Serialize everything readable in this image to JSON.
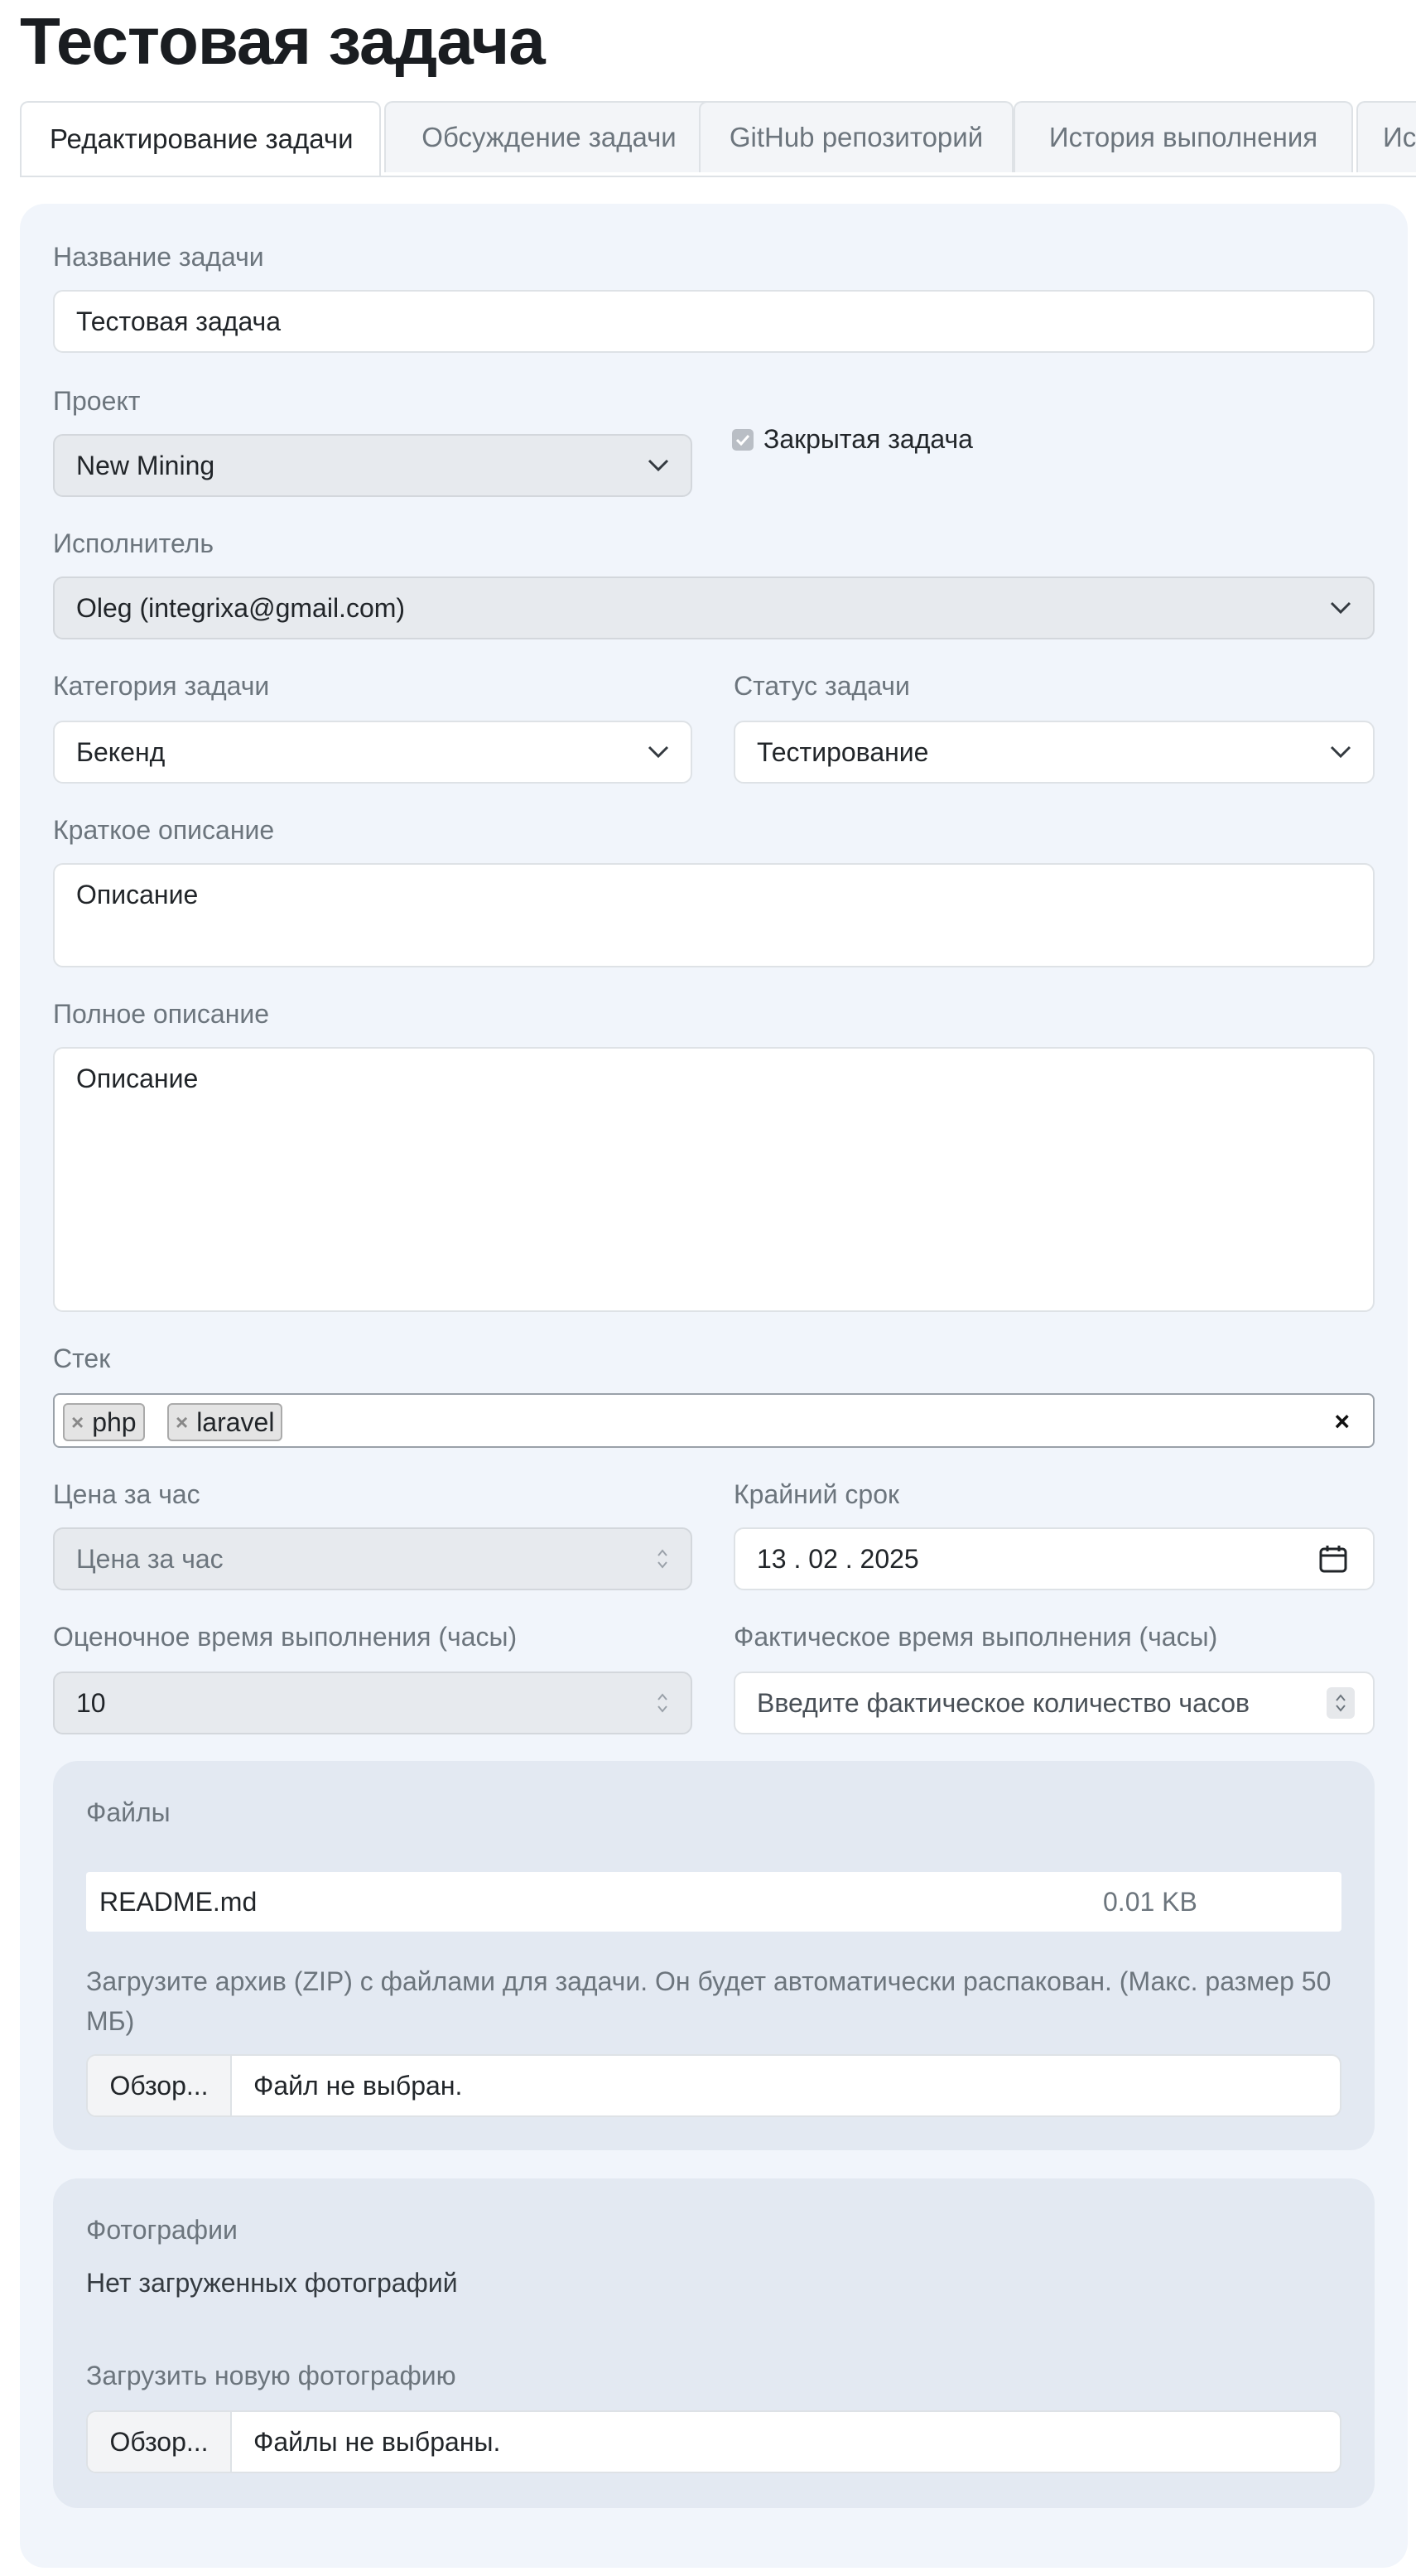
{
  "page_title": "Тестовая задача",
  "tabs": [
    {
      "label": "Редактирование задачи",
      "active": true
    },
    {
      "label": "Обсуждение задачи"
    },
    {
      "label": "GitHub репозиторий"
    },
    {
      "label": "История выполнения"
    },
    {
      "label": "Ист"
    }
  ],
  "form": {
    "task_name": {
      "label": "Название задачи",
      "value": "Тестовая задача"
    },
    "project": {
      "label": "Проект",
      "value": "New Mining"
    },
    "closed_task": {
      "label": "Закрытая задача",
      "checked": true
    },
    "assignee": {
      "label": "Исполнитель",
      "value": "Oleg (integrixa@gmail.com)"
    },
    "category": {
      "label": "Категория задачи",
      "value": "Бекенд"
    },
    "status": {
      "label": "Статус задачи",
      "value": "Тестирование"
    },
    "short_desc": {
      "label": "Краткое описание",
      "value": "Описание"
    },
    "full_desc": {
      "label": "Полное описание",
      "value": "Описание"
    },
    "stack": {
      "label": "Стек",
      "tags": [
        "php",
        "laravel"
      ],
      "tag_remove": "×",
      "clear": "×"
    },
    "hourly_rate": {
      "label": "Цена за час",
      "placeholder": "Цена за час"
    },
    "deadline": {
      "label": "Крайний срок",
      "value": "13 . 02 . 2025"
    },
    "estimated_hours": {
      "label": "Оценочное время выполнения (часы)",
      "value": "10"
    },
    "actual_hours": {
      "label": "Фактическое время выполнения (часы)",
      "placeholder": "Введите фактическое количество часов"
    }
  },
  "files": {
    "title": "Файлы",
    "items": [
      {
        "name": "README.md",
        "size": "0.01 KB"
      }
    ],
    "hint": "Загрузите архив (ZIP) с файлами для задачи. Он будет автоматически распакован. (Макс. размер 50 МБ)",
    "browse_label": "Обзор...",
    "no_file": "Файл не выбран."
  },
  "photos": {
    "title": "Фотографии",
    "empty": "Нет загруженных фотографий",
    "upload_label": "Загрузить новую фотографию",
    "browse_label": "Обзор...",
    "no_files": "Файлы не выбраны."
  },
  "colors": {
    "card_bg": "#f1f5fb",
    "section_bg": "#e3e9f2",
    "disabled_bg": "#e7eaee",
    "muted_text": "#6c757d"
  }
}
